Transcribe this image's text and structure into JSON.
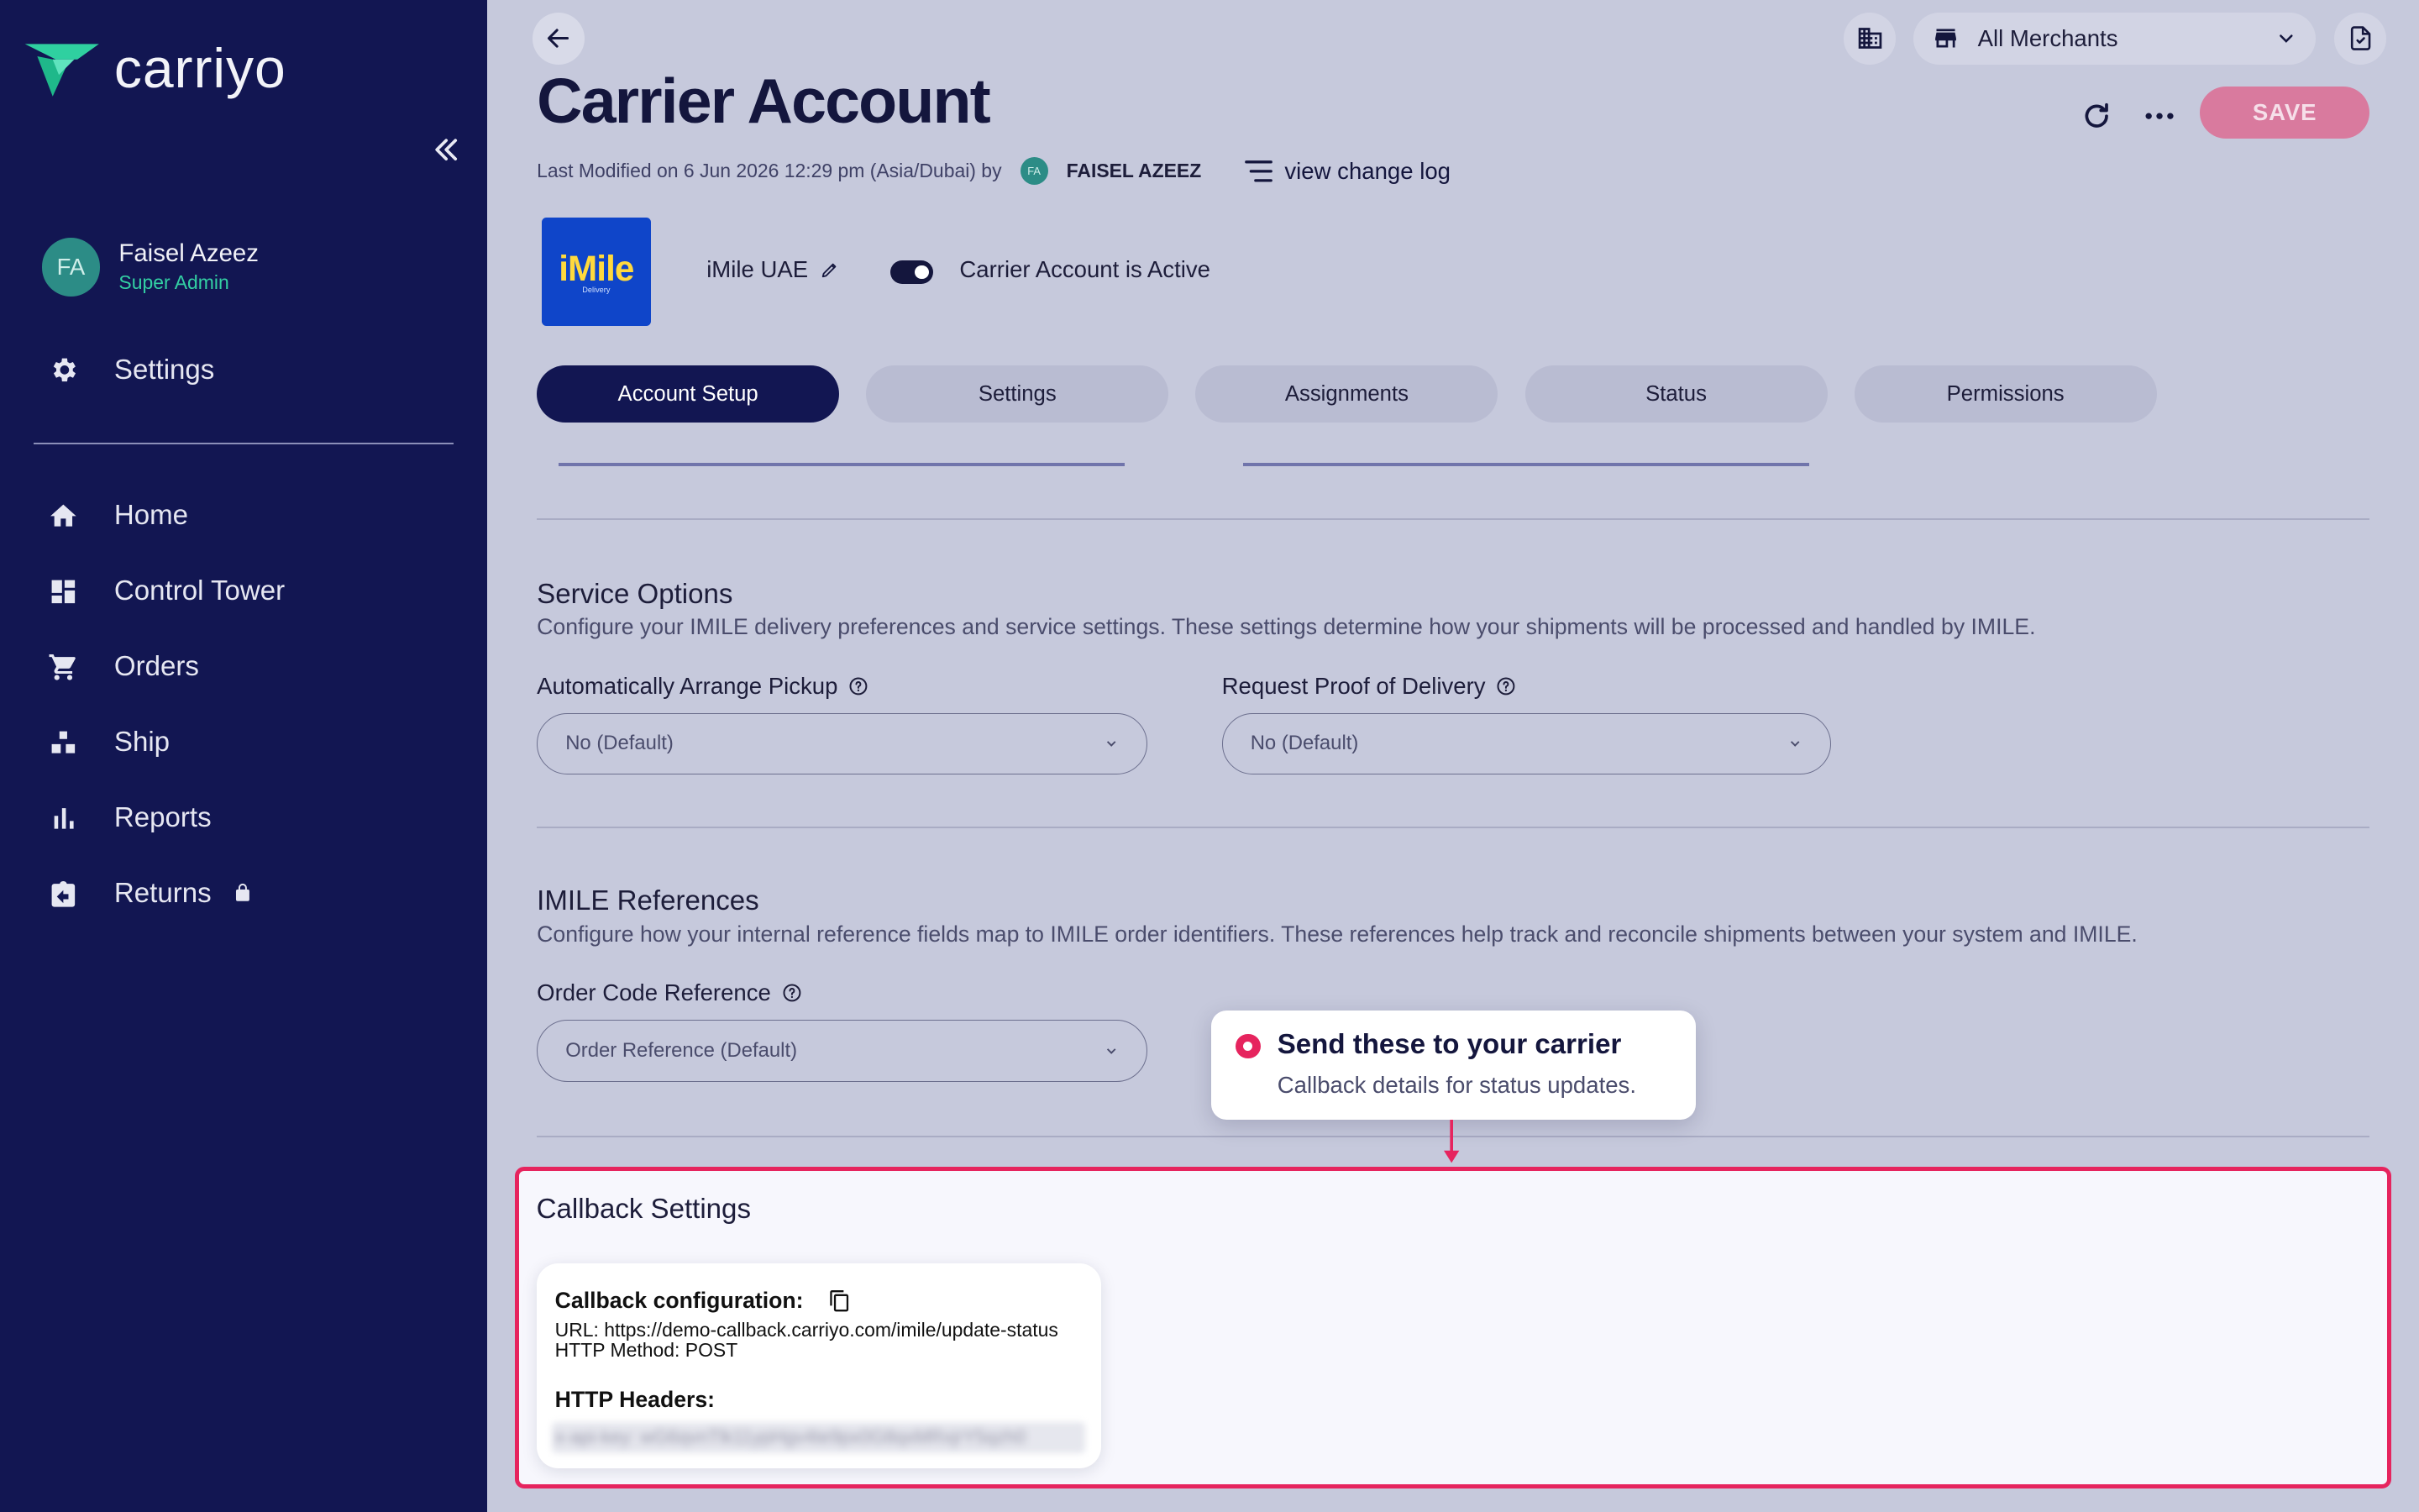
{
  "brand": {
    "name": "carriyo",
    "accent": "#e6245e",
    "sidebar_bg": "#121652",
    "logo_color": "#2fd0a0"
  },
  "user": {
    "initials": "FA",
    "name": "Faisel Azeez",
    "role": "Super Admin"
  },
  "sidebar": {
    "settings_label": "Settings",
    "items": [
      {
        "label": "Home",
        "icon": "home-icon"
      },
      {
        "label": "Control Tower",
        "icon": "dashboard-icon"
      },
      {
        "label": "Orders",
        "icon": "cart-icon"
      },
      {
        "label": "Ship",
        "icon": "ship-icon"
      },
      {
        "label": "Reports",
        "icon": "bar-chart-icon"
      },
      {
        "label": "Returns",
        "icon": "returns-icon",
        "locked": true
      }
    ]
  },
  "header": {
    "merchant_select": "All Merchants",
    "title": "Carrier Account",
    "save_label": "SAVE",
    "last_modified": "Last Modified on 6 Jun 2026 12:29 pm (Asia/Dubai) by",
    "modified_by_initials": "FA",
    "modified_by": "FAISEL AZEEZ",
    "change_log_label": "view change log"
  },
  "carrier": {
    "logo_text": "iMile",
    "logo_sub": "Delivery",
    "name": "iMile UAE",
    "active_label": "Carrier Account is Active",
    "active": true
  },
  "tabs": [
    {
      "label": "Account Setup",
      "active": true
    },
    {
      "label": "Settings",
      "active": false
    },
    {
      "label": "Assignments",
      "active": false
    },
    {
      "label": "Status",
      "active": false
    },
    {
      "label": "Permissions",
      "active": false
    }
  ],
  "service_options": {
    "title": "Service Options",
    "description": "Configure your IMILE delivery preferences and service settings. These settings determine how your shipments will be processed and handled by IMILE.",
    "pickup_label": "Automatically Arrange Pickup",
    "pickup_value": "No (Default)",
    "pod_label": "Request Proof of Delivery",
    "pod_value": "No (Default)"
  },
  "references": {
    "title": "IMILE References",
    "description": "Configure how your internal reference fields map to IMILE order identifiers. These references help track and reconcile shipments between your system and IMILE.",
    "order_code_label": "Order Code Reference",
    "order_code_value": "Order Reference (Default)"
  },
  "tooltip": {
    "title": "Send these to your carrier",
    "subtitle": "Callback details for status updates."
  },
  "callback": {
    "title": "Callback Settings",
    "config_label": "Callback configuration:",
    "url_line": "URL: https://demo-callback.carriyo.com/imile/update-status",
    "method_line": "HTTP Method: POST",
    "headers_label": "HTTP Headers:",
    "header_blurred": "x-api-key: wG6qvnTlk11ypHgv4te9px0G8qxMRxjrY5qzh0"
  }
}
